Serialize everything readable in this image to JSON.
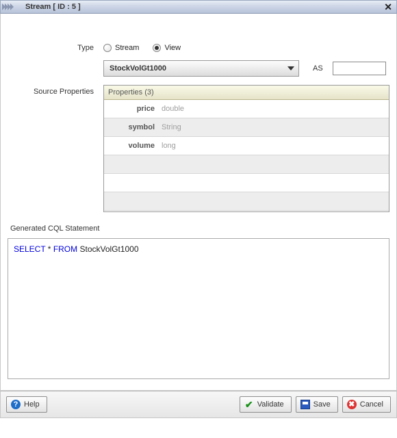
{
  "title": "Stream [ ID : 5 ]",
  "labels": {
    "type": "Type",
    "source_props": "Source Properties",
    "generated_cql": "Generated CQL Statement",
    "as": "AS"
  },
  "radios": {
    "stream": "Stream",
    "view": "View",
    "selected": "view"
  },
  "select": {
    "value": "StockVolGt1000"
  },
  "as_value": "",
  "props": {
    "header": "Properties (3)",
    "rows": [
      {
        "name": "price",
        "type": "double"
      },
      {
        "name": "symbol",
        "type": "String"
      },
      {
        "name": "volume",
        "type": "long"
      }
    ]
  },
  "cql": {
    "kw1": "SELECT",
    "mid": " * ",
    "kw2": "FROM",
    "tail": " StockVolGt1000"
  },
  "buttons": {
    "help": "Help",
    "validate": "Validate",
    "save": "Save",
    "cancel": "Cancel"
  }
}
